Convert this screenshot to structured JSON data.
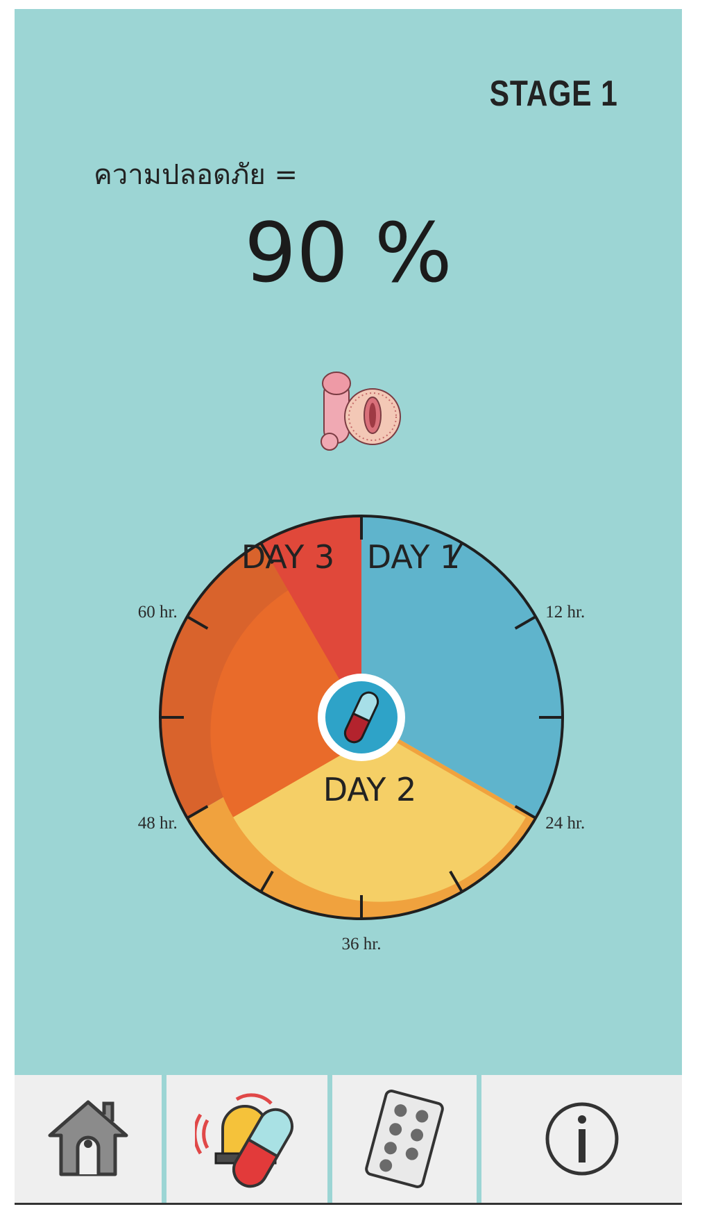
{
  "header": {
    "stage": "STAGE 1"
  },
  "safety": {
    "label": "ความปลอดภัย =",
    "value": "90 %"
  },
  "dial": {
    "days": [
      "DAY 1",
      "DAY 2",
      "DAY 3"
    ],
    "hour_labels": [
      "12 hr.",
      "24 hr.",
      "36 hr.",
      "48 hr.",
      "60 hr."
    ],
    "colors": {
      "day1": "#5fb4cc",
      "day2": "#f5cf66",
      "day3": "#e96b2a",
      "red_zone": "#e0483a",
      "center": "#2ea3c8"
    }
  },
  "icons": {
    "top": "genital-icon",
    "center": "pill-capsule-icon"
  },
  "nav": {
    "items": [
      "home-icon",
      "pill-alarm-icon",
      "pill-pack-icon",
      "info-icon"
    ]
  }
}
